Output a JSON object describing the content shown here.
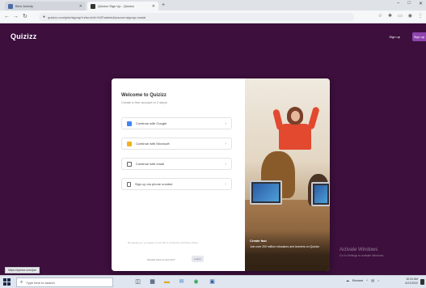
{
  "browser": {
    "tabs": [
      {
        "label": "Blerr Activity",
        "active": false
      },
      {
        "label": "Quizizz Sign Up - Quizizz",
        "active": true
      }
    ],
    "new_tab": "+",
    "window_controls": [
      "–",
      "□",
      "✕"
    ],
    "url": "quizizz.com/join/signup?returnUrl=%2Fadmin&source=signup-modal",
    "toolbar_icons": [
      "star-icon",
      "extensions-icon",
      "profile-icon",
      "menu-icon"
    ]
  },
  "header": {
    "logo": "Quizizz",
    "signin_label": "Sign up",
    "signup_label": "Sign up"
  },
  "modal": {
    "title": "Welcome to Quizizz",
    "subtitle": "Create a free account in 2 steps",
    "options": [
      {
        "label": "Continue with Google",
        "icon": "google-icon",
        "color": "#4285f4"
      },
      {
        "label": "Continue with Microsoft",
        "icon": "microsoft-icon",
        "color": "#f3b31e"
      },
      {
        "label": "Continue with email",
        "icon": "email-icon",
        "color": "#666666"
      },
      {
        "label": "Sign up via phone number",
        "icon": "phone-icon",
        "color": "#666666"
      }
    ],
    "terms": "By signing up, you agree to our Terms of Service & Privacy Policy",
    "have_account": "Already have an account?",
    "login_label": "Log in",
    "caption_title": "Create fast",
    "caption_text": "Join over 200 million educators and learners on Quizizz"
  },
  "watermark": {
    "line1": "Activate Windows",
    "line2": "Go to Settings to activate Windows."
  },
  "status_url": "https://quizizz.com/join",
  "taskbar": {
    "search_placeholder": "Type here to search",
    "tray_text": "Browse",
    "time": "10:24 AM",
    "date": "6/21/2022"
  },
  "colors": {
    "background": "#3c0f3c",
    "accent": "#8e44ad"
  }
}
